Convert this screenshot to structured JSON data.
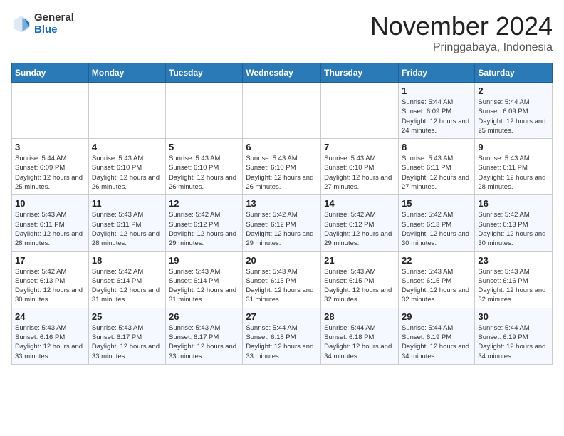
{
  "header": {
    "logo_general": "General",
    "logo_blue": "Blue",
    "month_year": "November 2024",
    "location": "Pringgabaya, Indonesia"
  },
  "days_of_week": [
    "Sunday",
    "Monday",
    "Tuesday",
    "Wednesday",
    "Thursday",
    "Friday",
    "Saturday"
  ],
  "weeks": [
    [
      {
        "day": "",
        "detail": ""
      },
      {
        "day": "",
        "detail": ""
      },
      {
        "day": "",
        "detail": ""
      },
      {
        "day": "",
        "detail": ""
      },
      {
        "day": "",
        "detail": ""
      },
      {
        "day": "1",
        "detail": "Sunrise: 5:44 AM\nSunset: 6:09 PM\nDaylight: 12 hours and 24 minutes."
      },
      {
        "day": "2",
        "detail": "Sunrise: 5:44 AM\nSunset: 6:09 PM\nDaylight: 12 hours and 25 minutes."
      }
    ],
    [
      {
        "day": "3",
        "detail": "Sunrise: 5:44 AM\nSunset: 6:09 PM\nDaylight: 12 hours and 25 minutes."
      },
      {
        "day": "4",
        "detail": "Sunrise: 5:43 AM\nSunset: 6:10 PM\nDaylight: 12 hours and 26 minutes."
      },
      {
        "day": "5",
        "detail": "Sunrise: 5:43 AM\nSunset: 6:10 PM\nDaylight: 12 hours and 26 minutes."
      },
      {
        "day": "6",
        "detail": "Sunrise: 5:43 AM\nSunset: 6:10 PM\nDaylight: 12 hours and 26 minutes."
      },
      {
        "day": "7",
        "detail": "Sunrise: 5:43 AM\nSunset: 6:10 PM\nDaylight: 12 hours and 27 minutes."
      },
      {
        "day": "8",
        "detail": "Sunrise: 5:43 AM\nSunset: 6:11 PM\nDaylight: 12 hours and 27 minutes."
      },
      {
        "day": "9",
        "detail": "Sunrise: 5:43 AM\nSunset: 6:11 PM\nDaylight: 12 hours and 28 minutes."
      }
    ],
    [
      {
        "day": "10",
        "detail": "Sunrise: 5:43 AM\nSunset: 6:11 PM\nDaylight: 12 hours and 28 minutes."
      },
      {
        "day": "11",
        "detail": "Sunrise: 5:43 AM\nSunset: 6:11 PM\nDaylight: 12 hours and 28 minutes."
      },
      {
        "day": "12",
        "detail": "Sunrise: 5:42 AM\nSunset: 6:12 PM\nDaylight: 12 hours and 29 minutes."
      },
      {
        "day": "13",
        "detail": "Sunrise: 5:42 AM\nSunset: 6:12 PM\nDaylight: 12 hours and 29 minutes."
      },
      {
        "day": "14",
        "detail": "Sunrise: 5:42 AM\nSunset: 6:12 PM\nDaylight: 12 hours and 29 minutes."
      },
      {
        "day": "15",
        "detail": "Sunrise: 5:42 AM\nSunset: 6:13 PM\nDaylight: 12 hours and 30 minutes."
      },
      {
        "day": "16",
        "detail": "Sunrise: 5:42 AM\nSunset: 6:13 PM\nDaylight: 12 hours and 30 minutes."
      }
    ],
    [
      {
        "day": "17",
        "detail": "Sunrise: 5:42 AM\nSunset: 6:13 PM\nDaylight: 12 hours and 30 minutes."
      },
      {
        "day": "18",
        "detail": "Sunrise: 5:42 AM\nSunset: 6:14 PM\nDaylight: 12 hours and 31 minutes."
      },
      {
        "day": "19",
        "detail": "Sunrise: 5:43 AM\nSunset: 6:14 PM\nDaylight: 12 hours and 31 minutes."
      },
      {
        "day": "20",
        "detail": "Sunrise: 5:43 AM\nSunset: 6:15 PM\nDaylight: 12 hours and 31 minutes."
      },
      {
        "day": "21",
        "detail": "Sunrise: 5:43 AM\nSunset: 6:15 PM\nDaylight: 12 hours and 32 minutes."
      },
      {
        "day": "22",
        "detail": "Sunrise: 5:43 AM\nSunset: 6:15 PM\nDaylight: 12 hours and 32 minutes."
      },
      {
        "day": "23",
        "detail": "Sunrise: 5:43 AM\nSunset: 6:16 PM\nDaylight: 12 hours and 32 minutes."
      }
    ],
    [
      {
        "day": "24",
        "detail": "Sunrise: 5:43 AM\nSunset: 6:16 PM\nDaylight: 12 hours and 33 minutes."
      },
      {
        "day": "25",
        "detail": "Sunrise: 5:43 AM\nSunset: 6:17 PM\nDaylight: 12 hours and 33 minutes."
      },
      {
        "day": "26",
        "detail": "Sunrise: 5:43 AM\nSunset: 6:17 PM\nDaylight: 12 hours and 33 minutes."
      },
      {
        "day": "27",
        "detail": "Sunrise: 5:44 AM\nSunset: 6:18 PM\nDaylight: 12 hours and 33 minutes."
      },
      {
        "day": "28",
        "detail": "Sunrise: 5:44 AM\nSunset: 6:18 PM\nDaylight: 12 hours and 34 minutes."
      },
      {
        "day": "29",
        "detail": "Sunrise: 5:44 AM\nSunset: 6:19 PM\nDaylight: 12 hours and 34 minutes."
      },
      {
        "day": "30",
        "detail": "Sunrise: 5:44 AM\nSunset: 6:19 PM\nDaylight: 12 hours and 34 minutes."
      }
    ]
  ]
}
